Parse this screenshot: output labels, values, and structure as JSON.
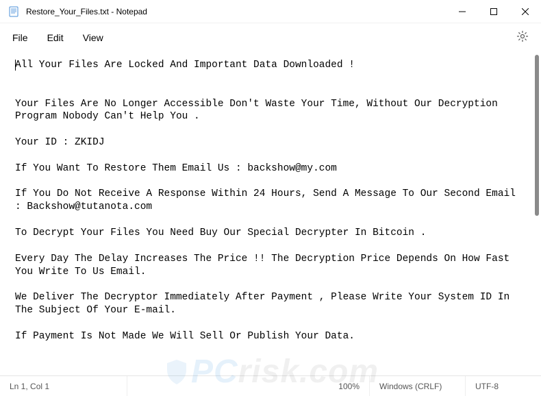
{
  "window": {
    "title": "Restore_Your_Files.txt - Notepad",
    "icon": "notepad-icon"
  },
  "menubar": {
    "file": "File",
    "edit": "Edit",
    "view": "View"
  },
  "document": {
    "body": "All Your Files Are Locked And Important Data Downloaded !\n\n\nYour Files Are No Longer Accessible Don't Waste Your Time, Without Our Decryption Program Nobody Can't Help You .\n\nYour ID : ZKIDJ\n\nIf You Want To Restore Them Email Us : backshow@my.com\n\nIf You Do Not Receive A Response Within 24 Hours, Send A Message To Our Second Email : Backshow@tutanota.com\n\nTo Decrypt Your Files You Need Buy Our Special Decrypter In Bitcoin .\n\nEvery Day The Delay Increases The Price !! The Decryption Price Depends On How Fast You Write To Us Email.\n\nWe Deliver The Decryptor Immediately After Payment , Please Write Your System ID In The Subject Of Your E-mail.\n\nIf Payment Is Not Made We Will Sell Or Publish Your Data."
  },
  "statusbar": {
    "position": "Ln 1, Col 1",
    "zoom": "100%",
    "line_ending": "Windows (CRLF)",
    "encoding": "UTF-8"
  },
  "watermark": {
    "prefix_icon": "shield",
    "text_pc": "PC",
    "text_rest": "risk.com"
  }
}
